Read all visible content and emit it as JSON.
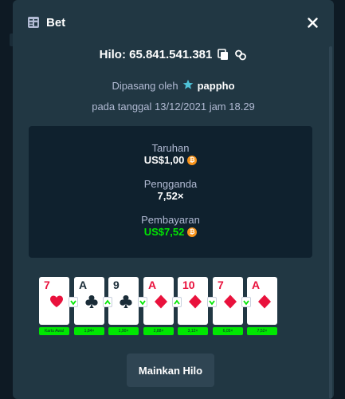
{
  "header": {
    "title": "Bet"
  },
  "bet": {
    "id_text": "Hilo: 65.841.541.381",
    "placed_by_prefix": "Dipasang oleh",
    "username": "pappho",
    "date_line": "pada tanggal 13/12/2021 jam 18.29"
  },
  "stats": {
    "wager_label": "Taruhan",
    "wager_value": "US$1,00",
    "multiplier_label": "Pengganda",
    "multiplier_value": "7,52×",
    "payout_label": "Pembayaran",
    "payout_value": "US$7,52"
  },
  "colors": {
    "win": "#00e701",
    "coin": "#f7931a",
    "card_red": "#e9113c",
    "card_black": "#1a2c38"
  },
  "cards": [
    {
      "rank": "7",
      "suit": "heart",
      "color": "red",
      "badge": "Kartu Awal"
    },
    {
      "rank": "A",
      "suit": "club",
      "color": "black",
      "badge": "1,84×",
      "arrow": "down"
    },
    {
      "rank": "9",
      "suit": "club",
      "color": "black",
      "badge": "1,90×",
      "arrow": "up"
    },
    {
      "rank": "A",
      "suit": "diamond",
      "color": "red",
      "badge": "2,88×",
      "arrow": "down"
    },
    {
      "rank": "10",
      "suit": "diamond",
      "color": "red",
      "badge": "3,12×",
      "arrow": "up"
    },
    {
      "rank": "7",
      "suit": "diamond",
      "color": "red",
      "badge": "6,05×",
      "arrow": "down"
    },
    {
      "rank": "A",
      "suit": "diamond",
      "color": "red",
      "badge": "7,52×",
      "arrow": "down"
    }
  ],
  "play_button": {
    "label": "Mainkan Hilo"
  }
}
